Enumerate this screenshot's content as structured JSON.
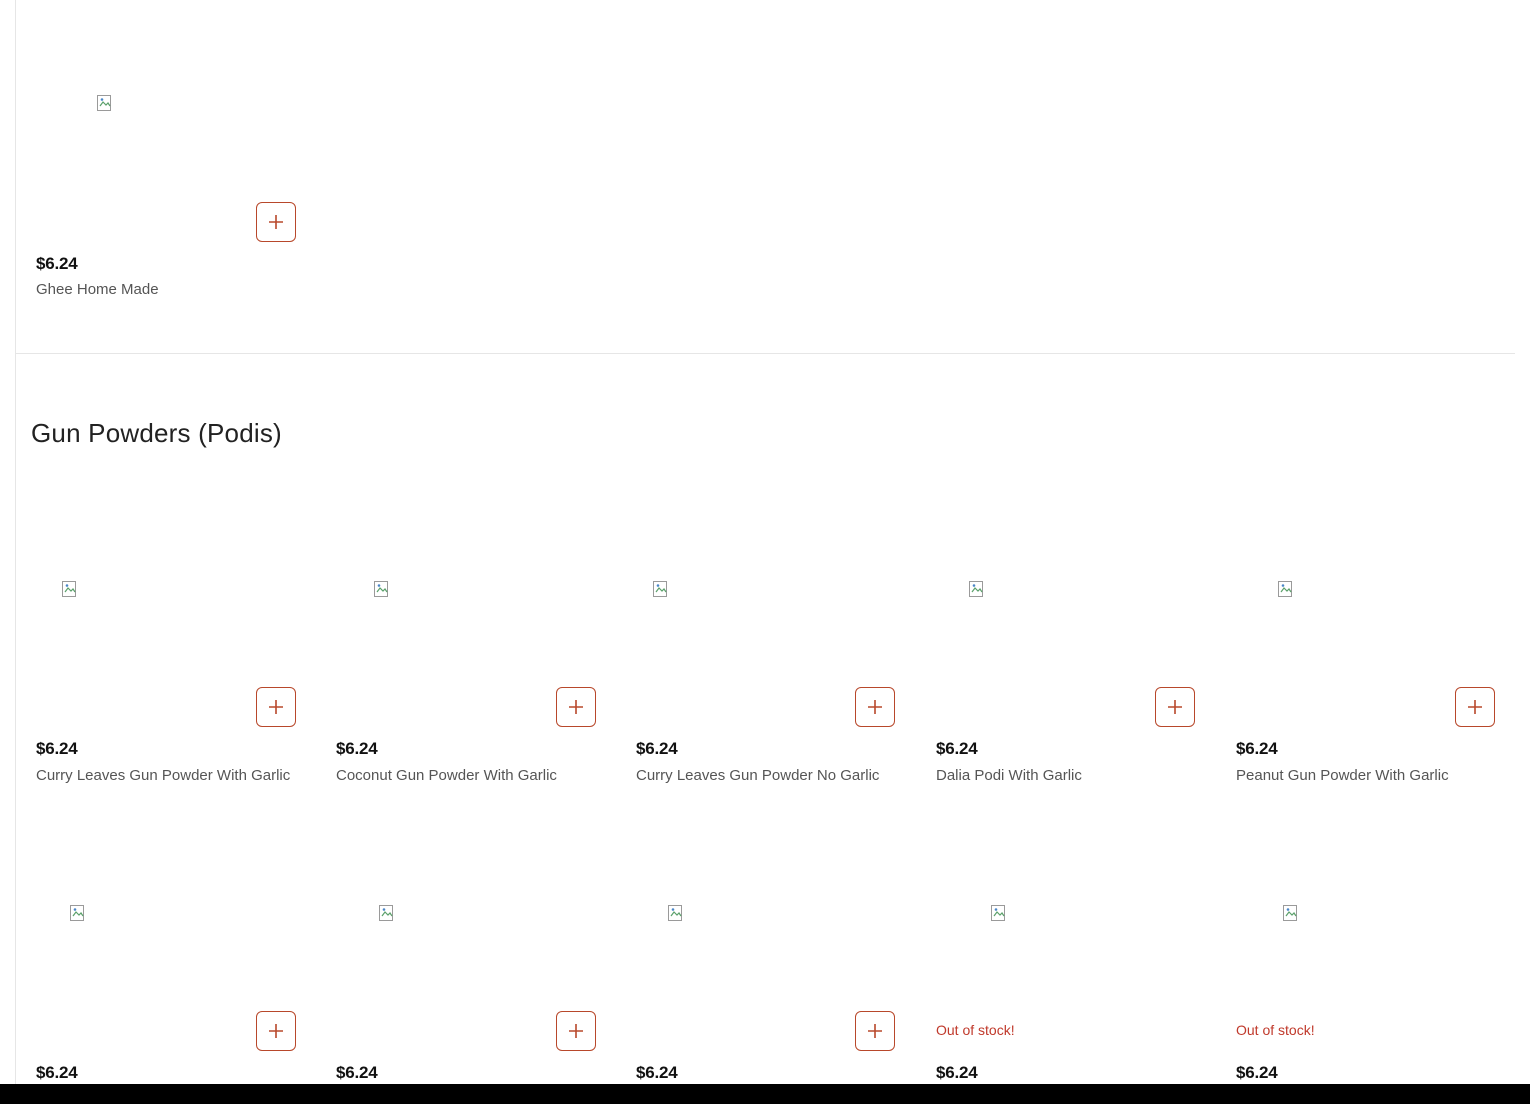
{
  "colors": {
    "accent": "#b8482b",
    "out_of_stock": "#c0392b"
  },
  "icons": {
    "add": "plus-icon",
    "image_placeholder": "broken-image-icon"
  },
  "top_item": {
    "price": "$6.24",
    "name": "Ghee Home Made"
  },
  "section": {
    "title": "Gun Powders (Podis)"
  },
  "row1": [
    {
      "price": "$6.24",
      "name": "Curry Leaves Gun Powder With Garlic"
    },
    {
      "price": "$6.24",
      "name": "Coconut Gun Powder With Garlic"
    },
    {
      "price": "$6.24",
      "name": "Curry Leaves Gun Powder No Garlic"
    },
    {
      "price": "$6.24",
      "name": "Dalia Podi With Garlic"
    },
    {
      "price": "$6.24",
      "name": "Peanut Gun Powder With Garlic"
    }
  ],
  "row2": [
    {
      "price": "$6.24",
      "status": ""
    },
    {
      "price": "$6.24",
      "status": ""
    },
    {
      "price": "$6.24",
      "status": ""
    },
    {
      "price": "$6.24",
      "status": "Out of stock!"
    },
    {
      "price": "$6.24",
      "status": "Out of stock!"
    }
  ]
}
